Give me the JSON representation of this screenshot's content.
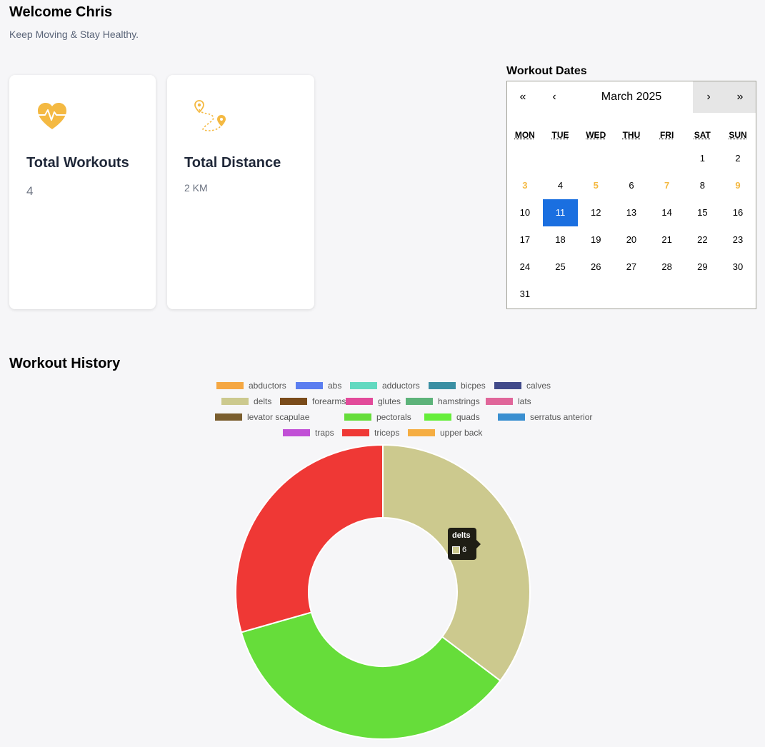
{
  "header": {
    "greeting": "Welcome Chris",
    "subtitle": "Keep Moving & Stay Healthy."
  },
  "cards": {
    "workouts": {
      "title": "Total Workouts",
      "value": "4",
      "icon": "heart-pulse-icon"
    },
    "distance": {
      "title": "Total Distance",
      "value": "2 KM",
      "icon": "route-pin-icon"
    }
  },
  "calendar": {
    "label": "Workout Dates",
    "month": "March 2025",
    "nav": {
      "prev_year": "«",
      "prev_month": "‹",
      "next_month": "›",
      "next_year": "»"
    },
    "weekdays": [
      "MON",
      "TUE",
      "WED",
      "THU",
      "FRI",
      "SAT",
      "SUN"
    ],
    "first_weekday_index": 5,
    "days_in_month": 31,
    "workout_days": [
      3,
      5,
      7,
      9
    ],
    "selected_day": 11,
    "accent_color": "#f4b942",
    "selected_color": "#1a6fe0"
  },
  "history": {
    "title": "Workout History",
    "legend": [
      {
        "label": "abductors",
        "color": "#f5a742"
      },
      {
        "label": "abs",
        "color": "#5b7ef0"
      },
      {
        "label": "adductors",
        "color": "#62d9c0"
      },
      {
        "label": "bicpes",
        "color": "#3a8fa3"
      },
      {
        "label": "calves",
        "color": "#414a8a"
      },
      {
        "label": "delts",
        "color": "#ccc98e"
      },
      {
        "label": "forearms",
        "color": "#7a4b1a"
      },
      {
        "label": "glutes",
        "color": "#e24a9a"
      },
      {
        "label": "hamstrings",
        "color": "#5db37a"
      },
      {
        "label": "lats",
        "color": "#e0669a"
      },
      {
        "label": "levator scapulae",
        "color": "#7a5e2e"
      },
      {
        "label": "pectorals",
        "color": "#66dd3a"
      },
      {
        "label": "quads",
        "color": "#66ee3a"
      },
      {
        "label": "serratus anterior",
        "color": "#3a8fd0"
      },
      {
        "label": "traps",
        "color": "#c14fd6"
      },
      {
        "label": "triceps",
        "color": "#ef3835"
      },
      {
        "label": "upper back",
        "color": "#f5ad42"
      }
    ],
    "tooltip": {
      "label": "delts",
      "value": "6",
      "color": "#ccc98e"
    }
  },
  "chart_data": {
    "type": "pie",
    "variant": "doughnut",
    "categories": [
      "delts",
      "pectorals",
      "triceps"
    ],
    "values": [
      6,
      6,
      5
    ],
    "colors": [
      "#ccc98e",
      "#66dd3a",
      "#ef3835"
    ],
    "title": "Workout History",
    "legend_position": "top"
  }
}
